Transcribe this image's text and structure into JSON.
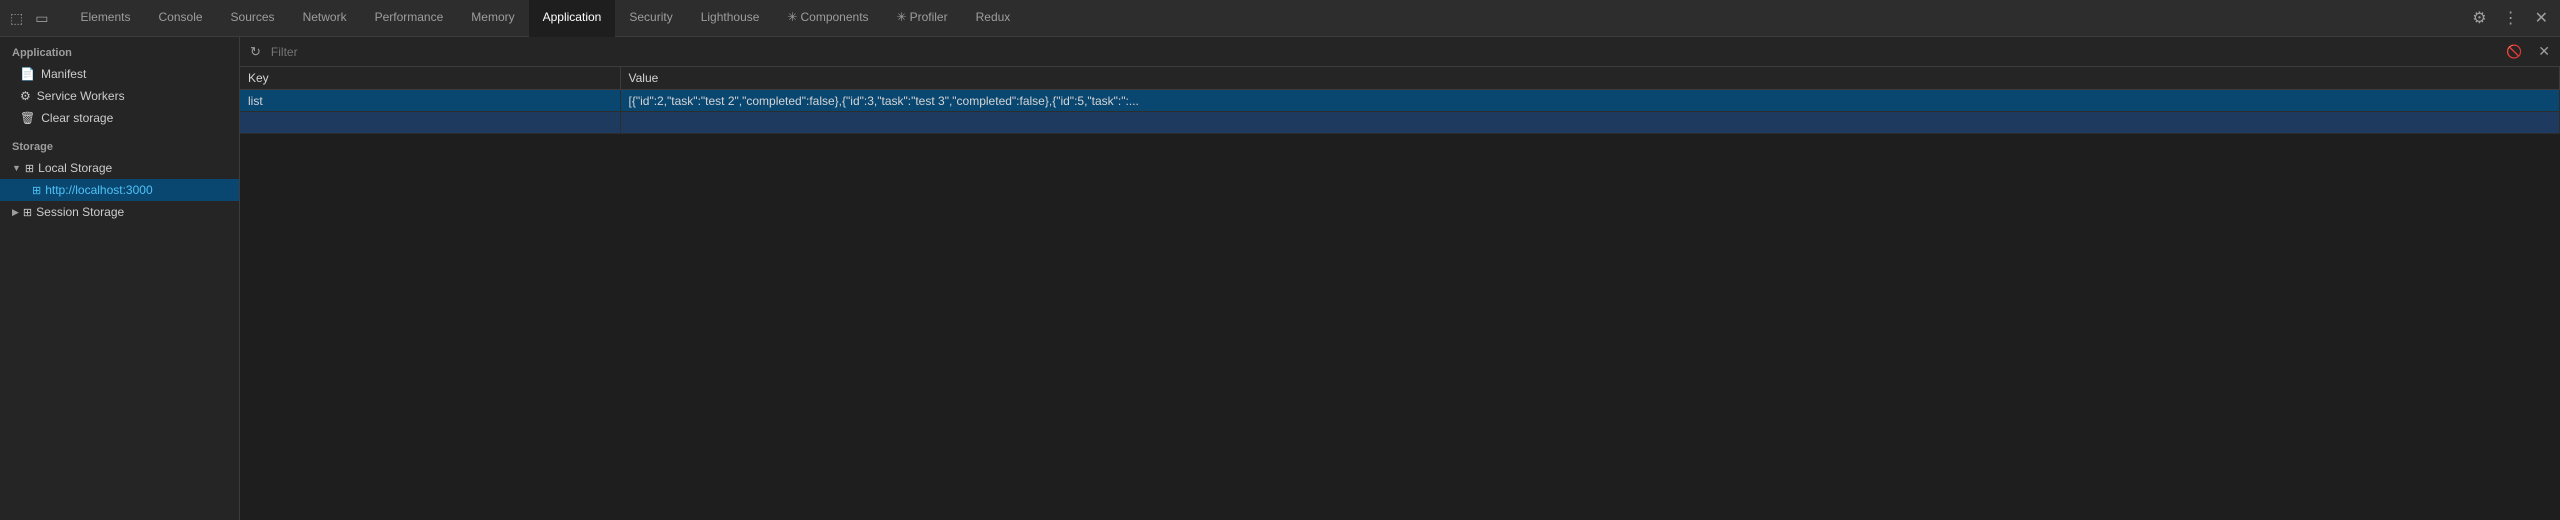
{
  "tabBar": {
    "icons": [
      {
        "name": "inspect-icon",
        "symbol": "⬚"
      },
      {
        "name": "device-icon",
        "symbol": "⬜"
      }
    ],
    "tabs": [
      {
        "id": "elements",
        "label": "Elements",
        "active": false
      },
      {
        "id": "console",
        "label": "Console",
        "active": false
      },
      {
        "id": "sources",
        "label": "Sources",
        "active": false
      },
      {
        "id": "network",
        "label": "Network",
        "active": false
      },
      {
        "id": "performance",
        "label": "Performance",
        "active": false
      },
      {
        "id": "memory",
        "label": "Memory",
        "active": false
      },
      {
        "id": "application",
        "label": "Application",
        "active": true
      },
      {
        "id": "security",
        "label": "Security",
        "active": false
      },
      {
        "id": "lighthouse",
        "label": "Lighthouse",
        "active": false
      },
      {
        "id": "components",
        "label": "Components",
        "active": false,
        "prefix": "✳"
      },
      {
        "id": "profiler",
        "label": "Profiler",
        "active": false,
        "prefix": "✳"
      },
      {
        "id": "redux",
        "label": "Redux",
        "active": false
      }
    ],
    "rightIcons": [
      {
        "name": "settings-icon",
        "symbol": "⚙"
      },
      {
        "name": "more-icon",
        "symbol": "⋮"
      },
      {
        "name": "close-icon",
        "symbol": "✕"
      }
    ]
  },
  "sidebar": {
    "applicationSection": {
      "label": "Application",
      "items": [
        {
          "id": "manifest",
          "label": "Manifest",
          "icon": "📄"
        },
        {
          "id": "service-workers",
          "label": "Service Workers",
          "icon": "⚙"
        },
        {
          "id": "clear-storage",
          "label": "Clear storage",
          "icon": "🗑"
        }
      ]
    },
    "storageSection": {
      "label": "Storage",
      "items": [
        {
          "id": "local-storage",
          "label": "Local Storage",
          "icon": "⊞",
          "expanded": true,
          "children": [
            {
              "id": "localhost-3000",
              "label": "http://localhost:3000",
              "icon": "⊞",
              "active": true
            }
          ]
        },
        {
          "id": "session-storage",
          "label": "Session Storage",
          "icon": "⊞",
          "expanded": false,
          "children": []
        }
      ]
    }
  },
  "filterBar": {
    "placeholder": "Filter",
    "refreshLabel": "↻",
    "clearLabel": "🚫",
    "closeLabel": "✕"
  },
  "table": {
    "columns": [
      {
        "id": "key",
        "label": "Key"
      },
      {
        "id": "value",
        "label": "Value"
      }
    ],
    "rows": [
      {
        "key": "list",
        "value": "[{\"id\":2,\"task\":\"test 2\",\"completed\":false},{\"id\":3,\"task\":\"test 3\",\"completed\":false},{\"id\":5,\"task\":\":...",
        "selected": true
      },
      {
        "key": "",
        "value": "",
        "selected": false,
        "secondary": true
      }
    ]
  }
}
